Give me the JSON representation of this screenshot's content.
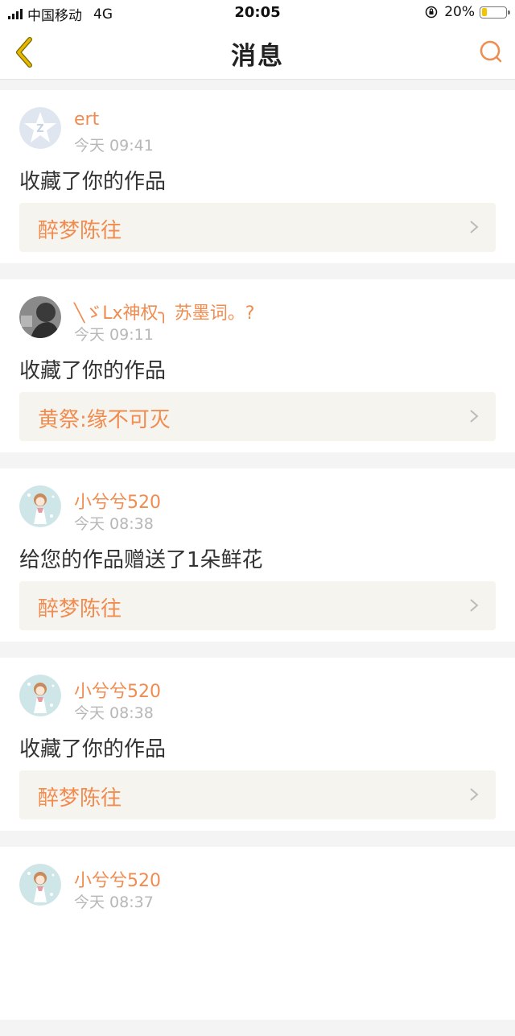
{
  "status_bar": {
    "carrier": "中国移动",
    "network": "4G",
    "time": "20:05",
    "battery": "20%",
    "battery_level": 0.2
  },
  "navbar": {
    "title": "消息",
    "back_icon": "chevron-left-icon",
    "search_icon": "search-icon"
  },
  "colors": {
    "accent": "#f08c50",
    "back_arrow": "#e6b800",
    "work_bg": "#f5f4ee"
  },
  "messages": [
    {
      "user": "ert",
      "time": "今天 09:41",
      "action": "收藏了你的作品",
      "work": "醉梦陈往",
      "avatar": "qzone-logo"
    },
    {
      "user": "╲ゞLx神权╮ 苏墨词。?",
      "time": "今天 09:11",
      "action": "收藏了你的作品",
      "work": "黄祭:缘不可灭",
      "avatar": "photo"
    },
    {
      "user": "小兮兮520",
      "time": "今天 08:38",
      "action": "给您的作品赠送了1朵鲜花",
      "work": "醉梦陈往",
      "avatar": "anime-girl"
    },
    {
      "user": "小兮兮520",
      "time": "今天 08:38",
      "action": "收藏了你的作品",
      "work": "醉梦陈往",
      "avatar": "anime-girl"
    },
    {
      "user": "小兮兮520",
      "time": "今天 08:37",
      "action": "",
      "work": "",
      "avatar": "anime-girl"
    }
  ]
}
